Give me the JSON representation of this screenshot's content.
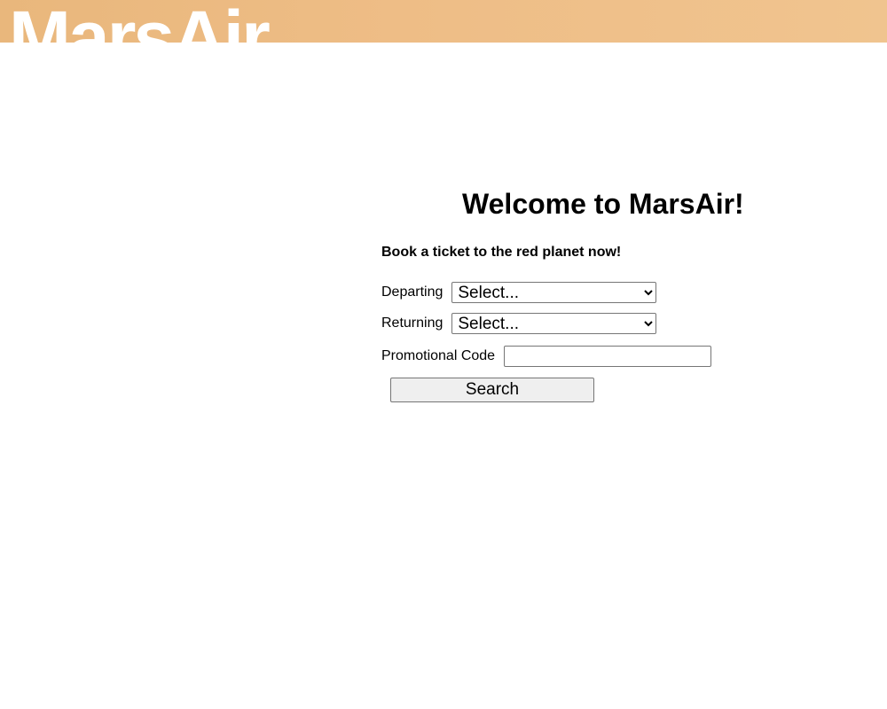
{
  "header": {
    "logo_text": "MarsAir",
    "background_color": "#ecbb84"
  },
  "main": {
    "title": "Welcome to MarsAir!",
    "subtitle": "Book a ticket to the red planet now!"
  },
  "form": {
    "departing_label": "Departing",
    "departing_value": "Select...",
    "returning_label": "Returning",
    "returning_value": "Select...",
    "promo_label": "Promotional Code",
    "promo_value": "",
    "search_label": "Search"
  }
}
